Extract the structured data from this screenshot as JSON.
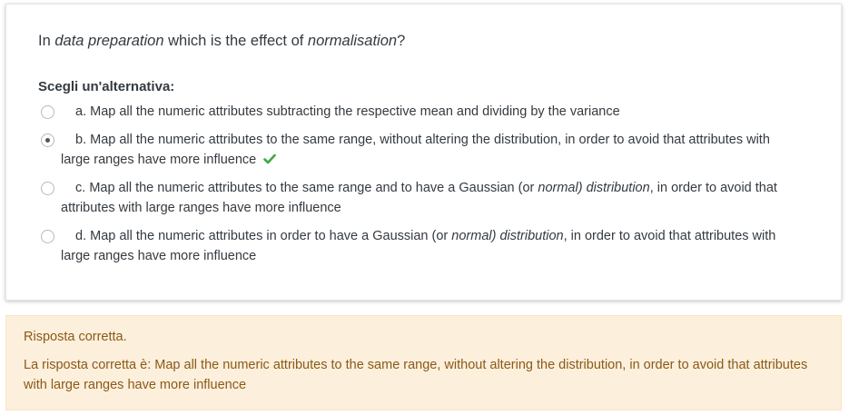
{
  "question": {
    "part1": "In ",
    "em1": "data preparation",
    "part2": " which is the effect of ",
    "em2": "normalisation",
    "part3": "?"
  },
  "prompt": "Scegli un'alternativa:",
  "options": [
    {
      "letter": "a.",
      "text": "Map all the numeric attributes subtracting the respective mean and dividing by the variance",
      "selected": false
    },
    {
      "letter": "b.",
      "text": "Map all the numeric attributes to the same range, without altering the distribution, in order to avoid that attributes with large ranges have more influence",
      "selected": true,
      "correct_icon": "check-icon"
    },
    {
      "letter": "c.",
      "text_before": "Map all the numeric attributes to the same range and to have a Gaussian (or ",
      "text_em": "normal) distribution",
      "text_after": ", in order to avoid that attributes with large ranges have more influence",
      "selected": false
    },
    {
      "letter": "d.",
      "text_before": "Map all the numeric attributes in order to have a Gaussian (or ",
      "text_em": "normal) distribution",
      "text_after": ", in order to avoid that attributes with large ranges have more influence",
      "selected": false
    }
  ],
  "feedback": {
    "status": "Risposta corretta.",
    "right_answer": "La risposta corretta è: Map all the numeric attributes to the same range, without altering the distribution, in order to avoid that attributes with large ranges have more influence"
  },
  "colors": {
    "feedback_bg": "#fcefdc",
    "feedback_text": "#8a5a17",
    "check": "#3fa83f"
  }
}
